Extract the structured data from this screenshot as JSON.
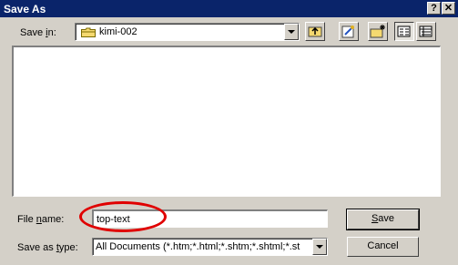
{
  "window": {
    "title": "Save As",
    "help_button": "?",
    "close_button": "✕"
  },
  "location": {
    "label_prefix": "Save ",
    "label_access": "i",
    "label_suffix": "n:",
    "folder_name": "kimi-002",
    "folder_icon": "folder-icon"
  },
  "toolbar": [
    {
      "name": "up-one-level-button",
      "icon": "up-folder-icon"
    },
    {
      "name": "look-in-favorites-button",
      "icon": "favorites-icon"
    },
    {
      "name": "create-new-folder-button",
      "icon": "new-folder-icon"
    },
    {
      "name": "list-view-button",
      "icon": "list-view-icon"
    },
    {
      "name": "details-view-button",
      "icon": "details-view-icon"
    }
  ],
  "filename": {
    "label_prefix": "File ",
    "label_access": "n",
    "label_suffix": "ame:",
    "value": "top-text"
  },
  "filetype": {
    "label_prefix": "Save as ",
    "label_access": "t",
    "label_suffix": "ype:",
    "value": "All Documents (*.htm;*.html;*.shtm;*.shtml;*.st"
  },
  "buttons": {
    "save_access": "S",
    "save_rest": "ave",
    "cancel": "Cancel"
  },
  "annotation": {
    "color": "#e00000"
  }
}
